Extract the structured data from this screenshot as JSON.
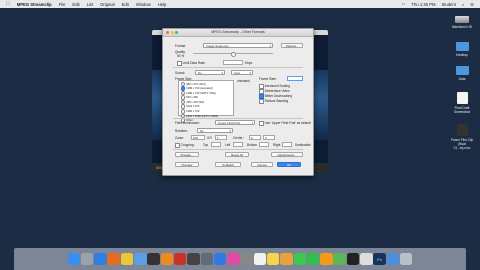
{
  "menubar": {
    "apple": "",
    "app": "MPEG Streamclip",
    "items": [
      "File",
      "Edit",
      "List",
      "Original",
      "Edit",
      "Window",
      "Help"
    ],
    "clock": "Thu 1:46 PM",
    "user": "Student"
  },
  "desktop": {
    "drive_label": "Macintosh HD",
    "folders": [
      "Desktop",
      "Data"
    ],
    "files": [
      "Final Draft Screenshot",
      "Power Film Clip (Boat 01...m).mov"
    ]
  },
  "dialog": {
    "title": "MPEG Streamclip - Other Formats",
    "format_label": "Format:",
    "format_value": "Image Sequence",
    "options_button": "Options...",
    "quality_label": "Quality",
    "quality_value": "50 %",
    "limit_label": "Limit Data Rate:",
    "limit_unit": "Kbps",
    "sound_label": "Sound:",
    "sound_value": "No",
    "sound_bitrate": "Auto",
    "frame_size_label": "Frame Size:",
    "frame_sizes": [
      "480 x 270 (16:9)",
      "1280 x 720 (unscaled)",
      "1280 x 720 (HDTV 720p)",
      "640 x 360",
      "768 x 432 (SD)",
      "1024 x 576",
      "1280 x 720",
      "1920 x 1080 (HDTV 1080i)"
    ],
    "unscaled_label": "unscaled",
    "other_label": "Other",
    "frame_rate_label": "Frame Rate:",
    "interlaced_label": "Interlaced Scaling",
    "deinterlace_label": "Deinterlace Video",
    "better_downscale_label": "Better Downscaling",
    "reduce_banding_label": "Reduce Banding",
    "field_dominance_label": "Field Dominance:",
    "field_dominance_value": "Upper Field First",
    "use_upper_label": "Use 'Upper Field First' as default",
    "rotation_label": "Rotation:",
    "rotation_value": "No",
    "zoom_label": "Zoom:",
    "zoom_value": "100",
    "xy_ratio_label": "X/Y",
    "xy_value": "1",
    "center_label": "Center:",
    "center_value": "0",
    "cropping_label": "Cropping:",
    "crop_top": "Top",
    "crop_left": "Left",
    "crop_bottom": "Bottom",
    "crop_right": "Right",
    "destination_label": "Destination",
    "presets_button": "Presets...",
    "reset_button": "Reset All",
    "adjustments_button": "Adjustments...",
    "preview_button": "Preview",
    "cancel_button": "Cancel",
    "ok_button": "OK",
    "to_batch_button": "To Batch"
  },
  "video": {
    "time": "00:00:00"
  },
  "dock": {
    "icons": [
      {
        "name": "finder-icon",
        "color": "#3b8ef0"
      },
      {
        "name": "launchpad-icon",
        "color": "#9aa3ad"
      },
      {
        "name": "safari-icon",
        "color": "#2f7fe0"
      },
      {
        "name": "firefox-icon",
        "color": "#e66a1f"
      },
      {
        "name": "chrome-icon",
        "color": "#e9c63a"
      },
      {
        "name": "mail-icon",
        "color": "#5aa0e6"
      },
      {
        "name": "clapper-icon",
        "color": "#333333"
      },
      {
        "name": "vlc-icon",
        "color": "#f08a1c"
      },
      {
        "name": "photo-booth-icon",
        "color": "#c8342a"
      },
      {
        "name": "film-icon",
        "color": "#444444"
      },
      {
        "name": "quicktime-icon",
        "color": "#5f6b78"
      },
      {
        "name": "app-store-icon",
        "color": "#2e7be8"
      },
      {
        "name": "itunes-icon",
        "color": "#e04aa0"
      },
      {
        "name": "system-prefs-icon",
        "color": "#888888"
      },
      {
        "name": "calendar-icon",
        "color": "#f2f2f2"
      },
      {
        "name": "notes-icon",
        "color": "#f7d44a"
      },
      {
        "name": "photos-icon",
        "color": "#e9a23b"
      },
      {
        "name": "messages-icon",
        "color": "#3ec750"
      },
      {
        "name": "facetime-icon",
        "color": "#2fbf4c"
      },
      {
        "name": "ibooks-icon",
        "color": "#f39a1a"
      },
      {
        "name": "maps-icon",
        "color": "#5bb65a"
      },
      {
        "name": "terminal-icon",
        "color": "#222222"
      },
      {
        "name": "texteditor-icon",
        "color": "#dedede"
      },
      {
        "name": "photoshop-icon",
        "color": "#1a3356"
      },
      {
        "name": "downloads-icon",
        "color": "#4a8fe0"
      },
      {
        "name": "trash-icon",
        "color": "#b9c0c8"
      }
    ],
    "ps_label": "Ps"
  }
}
